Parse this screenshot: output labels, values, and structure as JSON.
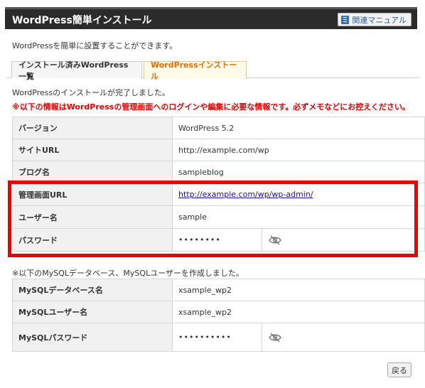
{
  "header": {
    "title": "WordPress簡単インストール",
    "manual_label": "関連マニュアル"
  },
  "intro": "WordPressを簡単に設置することができます。",
  "tabs": [
    {
      "label": "インストール済みWordPress一覧",
      "active": false
    },
    {
      "label": "WordPressインストール",
      "active": true
    }
  ],
  "message": {
    "done": "WordPressのインストールが完了しました。",
    "warning": "※以下の情報はWordPressの管理画面へのログインや編集に必要な情報です。必ずメモなどにお控えください。"
  },
  "wp_info": [
    {
      "label": "バージョン",
      "value": "WordPress 5.2"
    },
    {
      "label": "サイトURL",
      "value": "http://example.com/wp"
    },
    {
      "label": "ブログ名",
      "value": "sampleblog"
    },
    {
      "label": "管理画面URL",
      "value": "http://example.com/wp/wp-admin/"
    },
    {
      "label": "ユーザー名",
      "value": "sample"
    },
    {
      "label": "パスワード",
      "value": "••••••••"
    }
  ],
  "mysql_note": "※以下のMySQLデータベース、MySQLユーザーを作成しました。",
  "mysql_info": [
    {
      "label": "MySQLデータベース名",
      "value": "xsample_wp2"
    },
    {
      "label": "MySQLユーザー名",
      "value": "xsample_wp2"
    },
    {
      "label": "MySQLパスワード",
      "value": "••••••••••"
    }
  ],
  "footer": {
    "back_label": "戻る"
  },
  "colors": {
    "accent": "#e86b00",
    "warning": "#e60000",
    "highlight_box": "#ee0000",
    "titlebar": "#2b2b2b"
  }
}
